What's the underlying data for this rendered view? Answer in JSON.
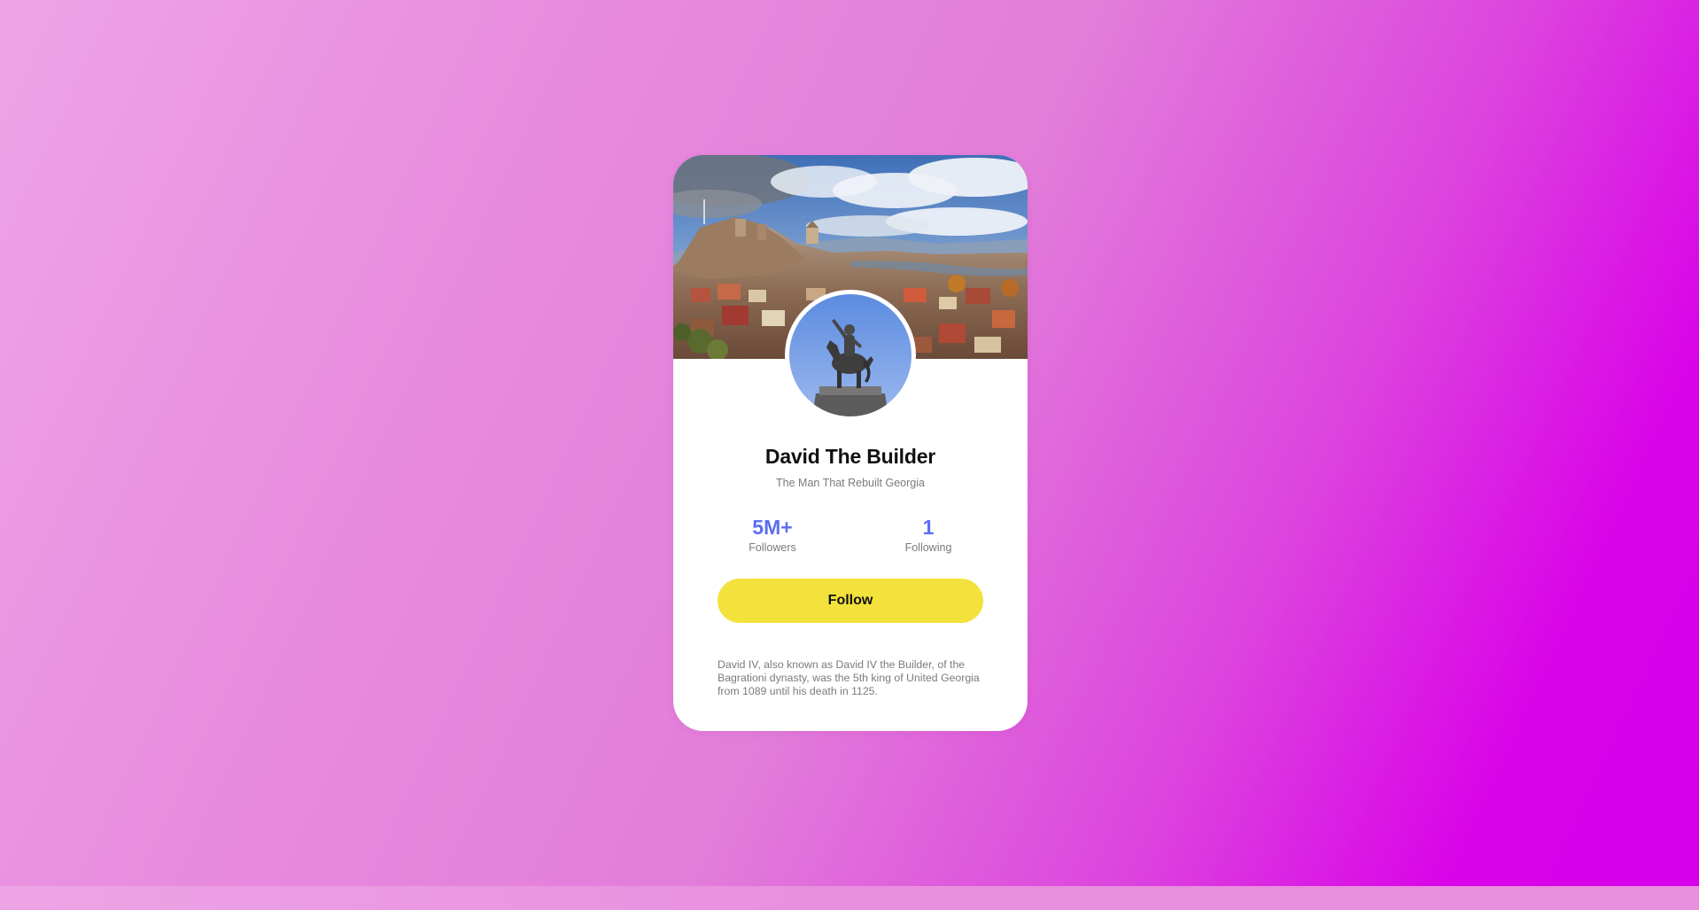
{
  "profile": {
    "name": "David The Builder",
    "subtitle": "The Man That Rebuilt Georgia",
    "stats": [
      {
        "value": "5M+",
        "label": "Followers"
      },
      {
        "value": "1",
        "label": "Following"
      }
    ],
    "follow_label": "Follow",
    "bio": "David IV, also known as David IV the Builder, of the Bagrationi dynasty, was the 5th king of United Georgia from 1089 until his death in 1125."
  },
  "icons": {
    "cover": "city-landscape-image",
    "avatar": "equestrian-statue-image"
  },
  "colors": {
    "accent": "#5d6ef2",
    "button": "#f3e23c",
    "background_start": "#eda4e6",
    "background_end": "#d800ea",
    "card": "#ffffff",
    "muted_text": "#7b7b7b"
  }
}
